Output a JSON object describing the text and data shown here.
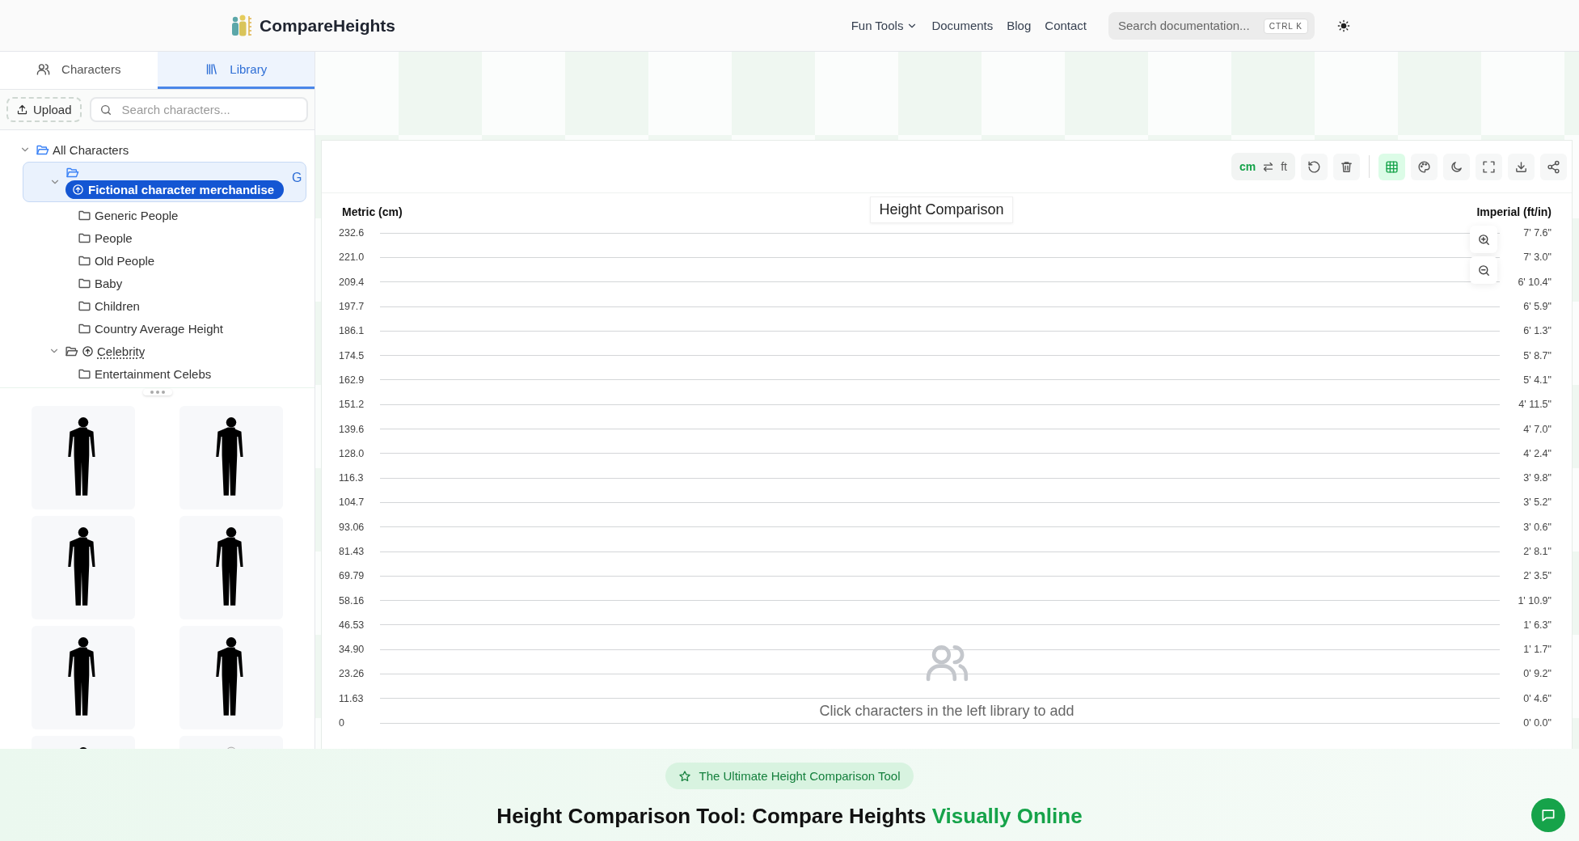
{
  "header": {
    "brand": "CompareHeights",
    "nav": [
      {
        "label": "Fun Tools",
        "kind": "dropdown"
      },
      {
        "label": "Documents",
        "kind": "link"
      },
      {
        "label": "Blog",
        "kind": "link"
      },
      {
        "label": "Contact",
        "kind": "link"
      }
    ],
    "search": {
      "placeholder": "Search documentation...",
      "shortcut": "CTRL K"
    }
  },
  "sidebar": {
    "tabs": [
      {
        "label": "Characters",
        "kind": "characters",
        "selected": false
      },
      {
        "label": "Library",
        "kind": "library",
        "selected": true
      }
    ],
    "upload_button": "Upload",
    "search": {
      "placeholder": "Search characters..."
    },
    "tree": [
      {
        "label": "All Characters",
        "kind": "folder",
        "expanded": true,
        "selected": false,
        "children": [
          {
            "label": "Fictional character merchandise",
            "kind": "category",
            "expanded": true,
            "selected": true,
            "tag": "G",
            "children": [
              {
                "label": "Generic People",
                "kind": "folder",
                "expanded": false,
                "selected": false
              },
              {
                "label": "People",
                "kind": "folder",
                "expanded": false,
                "selected": false
              },
              {
                "label": "Old People",
                "kind": "folder",
                "expanded": false,
                "selected": false
              },
              {
                "label": "Baby",
                "kind": "folder",
                "expanded": false,
                "selected": false
              },
              {
                "label": "Children",
                "kind": "folder",
                "expanded": false,
                "selected": false
              },
              {
                "label": "Country Average Height",
                "kind": "folder",
                "expanded": false,
                "selected": false
              }
            ]
          },
          {
            "label": "Celebrity",
            "kind": "category",
            "expanded": true,
            "selected": false,
            "children": [
              {
                "label": "Entertainment Celebs",
                "kind": "folder",
                "expanded": false,
                "selected": false
              }
            ]
          }
        ]
      }
    ],
    "library_items": [
      {
        "kind": "silhouette"
      },
      {
        "kind": "silhouette"
      },
      {
        "kind": "silhouette"
      },
      {
        "kind": "silhouette"
      },
      {
        "kind": "silhouette"
      },
      {
        "kind": "silhouette"
      },
      {
        "kind": "silhouette"
      },
      {
        "kind": "outline"
      }
    ]
  },
  "chart": {
    "unit_toggle": [
      {
        "label": "cm",
        "selected": true
      },
      {
        "label": "ft",
        "selected": false
      }
    ],
    "tool_groups": [
      [
        {
          "kind": "reset",
          "selected": false
        },
        {
          "kind": "delete",
          "selected": false
        }
      ],
      [
        {
          "kind": "grid",
          "selected": true
        },
        {
          "kind": "palette",
          "selected": false
        },
        {
          "kind": "theme",
          "selected": false
        },
        {
          "kind": "fullscreen",
          "selected": false
        },
        {
          "kind": "download",
          "selected": false
        },
        {
          "kind": "share",
          "selected": false
        }
      ]
    ],
    "title": "Height Comparison",
    "left_axis_label": "Metric (cm)",
    "right_axis_label": "Imperial (ft/in)",
    "metric_ticks": [
      "232.6",
      "221.0",
      "209.4",
      "197.7",
      "186.1",
      "174.5",
      "162.9",
      "151.2",
      "139.6",
      "128.0",
      "116.3",
      "104.7",
      "93.06",
      "81.43",
      "69.79",
      "58.16",
      "46.53",
      "34.90",
      "23.26",
      "11.63",
      "0"
    ],
    "imperial_ticks": [
      "7' 7.6\"",
      "7' 3.0\"",
      "6' 10.4\"",
      "6' 5.9\"",
      "6' 1.3\"",
      "5' 8.7\"",
      "5' 4.1\"",
      "4' 11.5\"",
      "4' 7.0\"",
      "4' 2.4\"",
      "3' 9.8\"",
      "3' 5.2\"",
      "3' 0.6\"",
      "2' 8.1\"",
      "2' 3.5\"",
      "1' 10.9\"",
      "1' 6.3\"",
      "1' 1.7\"",
      "0' 9.2\"",
      "0' 4.6\"",
      "0' 0.0\""
    ],
    "empty_message": "Click characters in the left library to add"
  },
  "hero": {
    "badge": "The Ultimate Height Comparison Tool",
    "heading": "Height Comparison Tool: Compare Heights",
    "heading_highlight": "Visually Online"
  }
}
